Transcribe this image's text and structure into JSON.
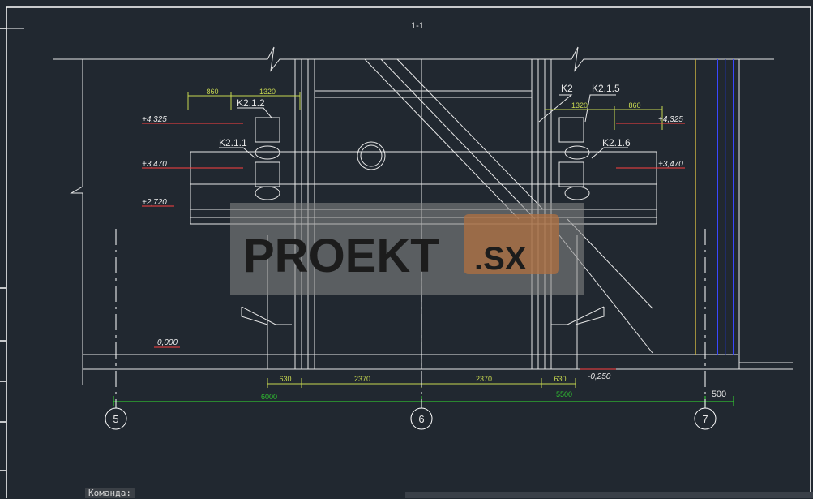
{
  "drawing": {
    "section_title": "1-1",
    "dims_top_left": [
      "860",
      "1320"
    ],
    "dims_top_right": [
      "1320",
      "860"
    ],
    "dims_bottom_1": [
      "630",
      "2370",
      "2370",
      "630"
    ],
    "dims_bottom_2": [
      "6000",
      "5500",
      "500"
    ],
    "elev_left": [
      "+4,325",
      "+3,470",
      "+2,720",
      "0,000"
    ],
    "elev_right": [
      "+4,325",
      "+3,470",
      "-0,250"
    ],
    "labels": [
      "K2.1.2",
      "K2.1.1",
      "K2",
      "K2.1.5",
      "K2.1.6"
    ],
    "axes": [
      "5",
      "6",
      "7"
    ]
  },
  "watermark": {
    "text_left": "PROEKT",
    "text_right": ".SX"
  },
  "command_line": {
    "label": "Команда:"
  },
  "colors": {
    "background": "#212830",
    "dimension": "#c8d850",
    "elevation": "#ff4040",
    "axis_line": "#30c030",
    "frame": "#ffffff"
  }
}
